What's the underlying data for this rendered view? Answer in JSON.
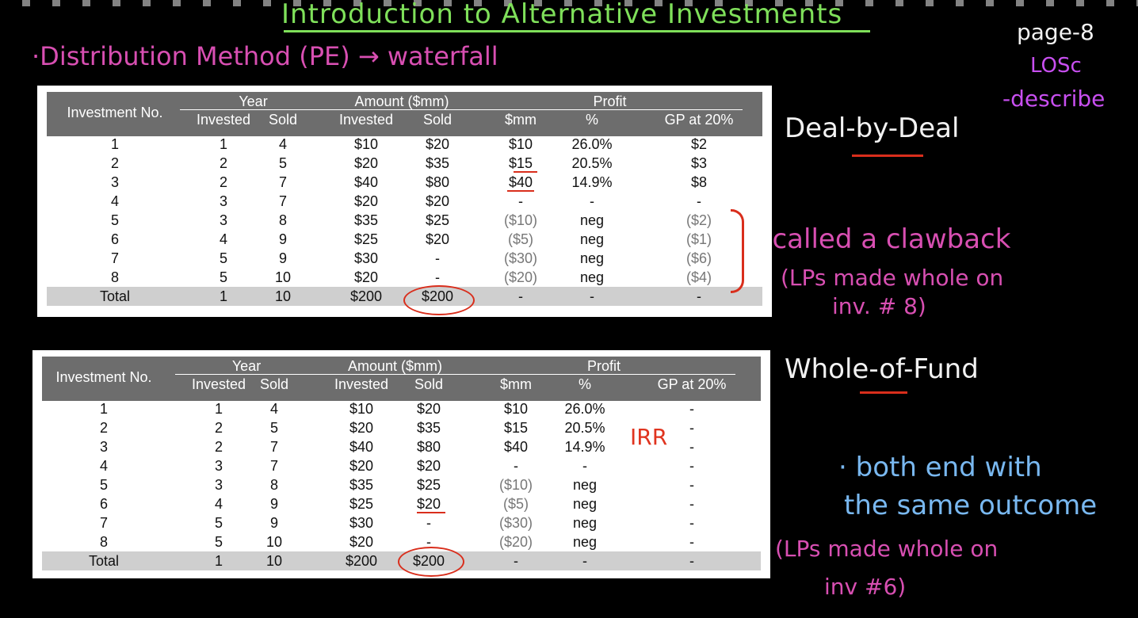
{
  "title": "Introduction to Alternative Investments",
  "notes": {
    "distribution": "·Distribution Method (PE) → waterfall",
    "page": "page-8",
    "los": "LOSc",
    "describe": "-describe",
    "deal_by_deal": "Deal-by-Deal",
    "clawback": "→called a clawback",
    "lps_whole_8_a": "(LPs made whole on",
    "lps_whole_8_b": "inv. # 8)",
    "whole_of_fund": "Whole-of-Fund",
    "irr": "IRR",
    "both_end_a": "· both end with",
    "both_end_b": "the same outcome",
    "lps_whole_6_a": "(LPs made whole on",
    "lps_whole_6_b": "inv #6)"
  },
  "table_headers": {
    "investment_no": "Investment No.",
    "year": "Year",
    "amount": "Amount ($mm)",
    "profit": "Profit",
    "invested": "Invested",
    "sold": "Sold",
    "mm": "$mm",
    "pct": "%",
    "gp": "GP at 20%"
  },
  "deal_table": {
    "rows": [
      [
        "1",
        "1",
        "4",
        "$10",
        "$20",
        "$10",
        "26.0%",
        "$2"
      ],
      [
        "2",
        "2",
        "5",
        "$20",
        "$35",
        "$15",
        "20.5%",
        "$3"
      ],
      [
        "3",
        "2",
        "7",
        "$40",
        "$80",
        "$40",
        "14.9%",
        "$8"
      ],
      [
        "4",
        "3",
        "7",
        "$20",
        "$20",
        "-",
        "-",
        "-"
      ],
      [
        "5",
        "3",
        "8",
        "$35",
        "$25",
        "($10)",
        "neg",
        "($2)"
      ],
      [
        "6",
        "4",
        "9",
        "$25",
        "$20",
        "($5)",
        "neg",
        "($1)"
      ],
      [
        "7",
        "5",
        "9",
        "$30",
        "-",
        "($30)",
        "neg",
        "($6)"
      ],
      [
        "8",
        "5",
        "10",
        "$20",
        "-",
        "($20)",
        "neg",
        "($4)"
      ]
    ],
    "total": [
      "Total",
      "1",
      "10",
      "$200",
      "$200",
      "-",
      "-",
      "-"
    ]
  },
  "fund_table": {
    "rows": [
      [
        "1",
        "1",
        "4",
        "$10",
        "$20",
        "$10",
        "26.0%",
        "-"
      ],
      [
        "2",
        "2",
        "5",
        "$20",
        "$35",
        "$15",
        "20.5%",
        "-"
      ],
      [
        "3",
        "2",
        "7",
        "$40",
        "$80",
        "$40",
        "14.9%",
        "-"
      ],
      [
        "4",
        "3",
        "7",
        "$20",
        "$20",
        "-",
        "-",
        "-"
      ],
      [
        "5",
        "3",
        "8",
        "$35",
        "$25",
        "($10)",
        "neg",
        "-"
      ],
      [
        "6",
        "4",
        "9",
        "$25",
        "$20",
        "($5)",
        "neg",
        "-"
      ],
      [
        "7",
        "5",
        "9",
        "$30",
        "-",
        "($30)",
        "neg",
        "-"
      ],
      [
        "8",
        "5",
        "10",
        "$20",
        "-",
        "($20)",
        "neg",
        "-"
      ]
    ],
    "total": [
      "Total",
      "1",
      "10",
      "$200",
      "$200",
      "-",
      "-",
      "-"
    ]
  }
}
